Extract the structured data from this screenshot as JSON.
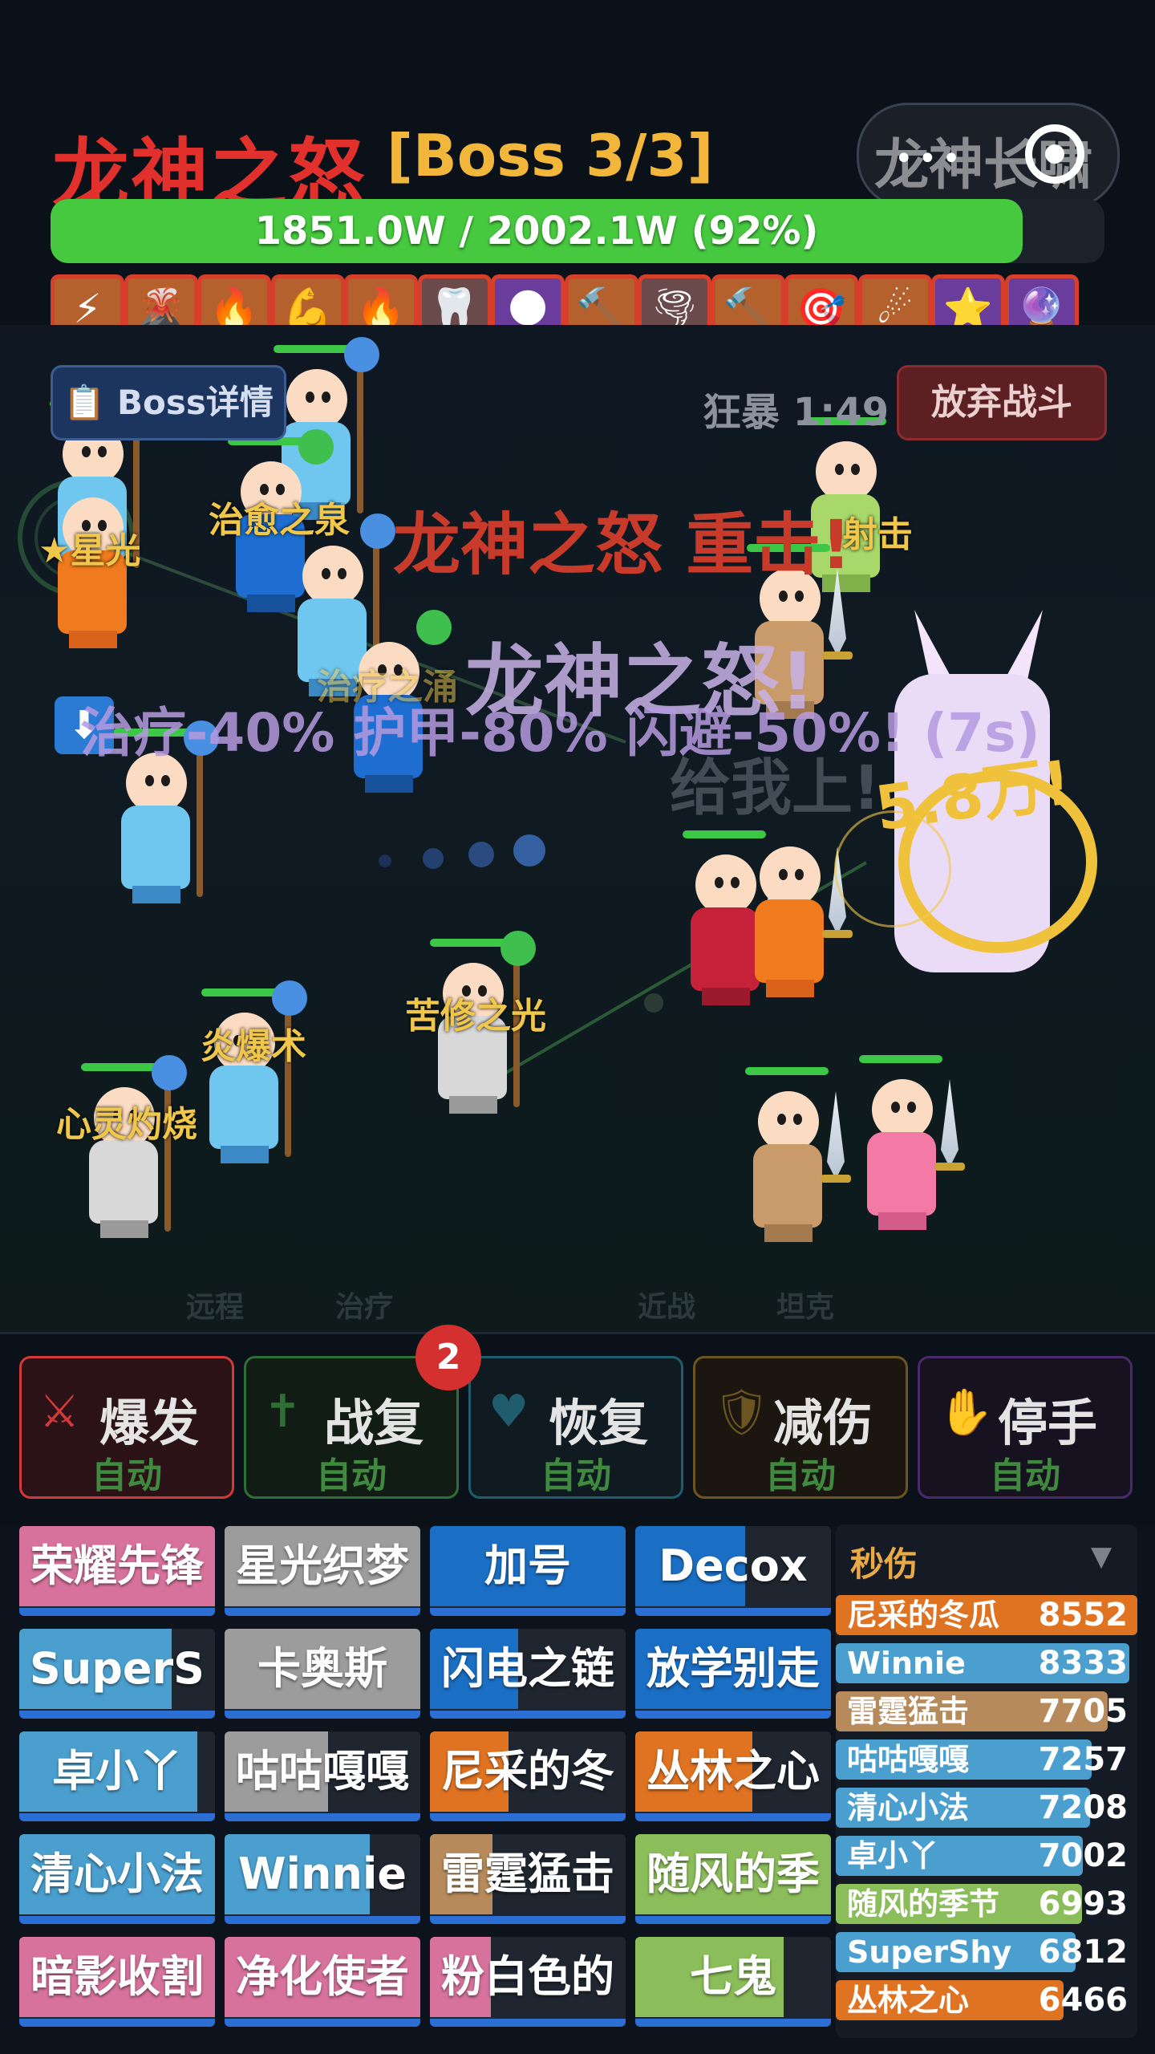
{
  "header": {
    "boss_name": "龙神之怒",
    "boss_count": "[Boss 3/3]",
    "capsule_title": "龙神长啸",
    "capsule_dots": "•••",
    "hp_text": "1851.0W / 2002.1W (92%)",
    "hp_ratio": 0.92,
    "buff_icons": [
      "⚡",
      "🌋",
      "🔥",
      "💪",
      "🔥",
      "🦷",
      "🌑",
      "🔨",
      "🌪",
      "🔨",
      "🎯",
      "☄",
      "⭐",
      "🔮"
    ]
  },
  "field": {
    "boss_detail_label": "📋 Boss详情",
    "frenzy_label": "狂暴 1:49",
    "abandon_label": "放弃战斗",
    "float_texts": {
      "crit": "龙神之怒 重击!",
      "wrath": "龙神之怒!",
      "debuff": "治疗-40% 护甲-80% 闪避-50%! (7s)",
      "debuff_icon": "⬇",
      "damage": "5.8万!",
      "taunt": "给我上!",
      "star": "★星光",
      "heal_flow": "治愈之泉",
      "heal_flow2": "治疗之涌",
      "shoot": "射击",
      "fire": "炎爆术",
      "ascetic": "苦修之光",
      "mind": "心灵灼烧"
    },
    "lane_labels": [
      "远程",
      "治疗",
      "近战",
      "坦克"
    ]
  },
  "stances": {
    "badge": "2",
    "items": [
      {
        "icon": "⚔",
        "name": "爆发",
        "auto": "自动",
        "color": "#d23a3a",
        "bg": "#2a1216",
        "auto_color": "#3f8a3f"
      },
      {
        "icon": "✝",
        "name": "战复",
        "auto": "自动",
        "color": "#2f6e37",
        "bg": "#101c14",
        "auto_color": "#3f8a3f"
      },
      {
        "icon": "♥",
        "name": "恢复",
        "auto": "自动",
        "color": "#1f5d6e",
        "bg": "#0f1b20",
        "auto_color": "#3f8a3f"
      },
      {
        "icon": "🛡",
        "name": "减伤",
        "auto": "自动",
        "color": "#6c5520",
        "bg": "#1b1710",
        "auto_color": "#3f8a3f"
      },
      {
        "icon": "✋",
        "name": "停手",
        "auto": "自动",
        "color": "#4a2a6a",
        "bg": "#16121f",
        "auto_color": "#3f8a3f"
      }
    ]
  },
  "raid": {
    "tiles": [
      {
        "name": "荣耀先锋",
        "color": "#d7729c",
        "hp": 1.0
      },
      {
        "name": "星光织梦",
        "color": "#9c9c9c",
        "hp": 1.0
      },
      {
        "name": "加号",
        "color": "#1a6ec4",
        "hp": 1.0
      },
      {
        "name": "Decox",
        "color": "#1a6ec4",
        "hp": 0.56
      },
      {
        "name": "SuperS",
        "color": "#4a9fcf",
        "hp": 0.78
      },
      {
        "name": "卡奥斯",
        "color": "#9c9c9c",
        "hp": 1.0
      },
      {
        "name": "闪电之链",
        "color": "#1a6ec4",
        "hp": 0.45
      },
      {
        "name": "放学别走",
        "color": "#1a6ec4",
        "hp": 1.0
      },
      {
        "name": "卓小丫",
        "color": "#4a9fcf",
        "hp": 0.91
      },
      {
        "name": "咕咕嘎嘎",
        "color": "#9c9c9c",
        "hp": 0.53
      },
      {
        "name": "尼采的冬",
        "color": "#e07321",
        "hp": 0.4
      },
      {
        "name": "丛林之心",
        "color": "#e07321",
        "hp": 0.6
      },
      {
        "name": "清心小法",
        "color": "#4a9fcf",
        "hp": 1.0
      },
      {
        "name": "Winnie",
        "color": "#4a9fcf",
        "hp": 0.74
      },
      {
        "name": "雷霆猛击",
        "color": "#b68a5a",
        "hp": 0.32
      },
      {
        "name": "随风的季",
        "color": "#8bbd5a",
        "hp": 1.0
      },
      {
        "name": "暗影收割",
        "color": "#d7729c",
        "hp": 1.0
      },
      {
        "name": "净化使者",
        "color": "#d7729c",
        "hp": 1.0
      },
      {
        "name": "粉白色的",
        "color": "#d7729c",
        "hp": 0.31
      },
      {
        "name": "七鬼",
        "color": "#8bbd5a",
        "hp": 0.76
      }
    ]
  },
  "meter": {
    "title": "秒伤",
    "arrow": "▼",
    "rows": [
      {
        "name": "尼采的冬瓜",
        "value": "8552",
        "color": "#e07321"
      },
      {
        "name": "Winnie",
        "value": "8333",
        "color": "#4a9fcf"
      },
      {
        "name": "雷霆猛击",
        "value": "7705",
        "color": "#b68a5a"
      },
      {
        "name": "咕咕嘎嘎",
        "value": "7257",
        "color": "#4a9fcf"
      },
      {
        "name": "清心小法",
        "value": "7208",
        "color": "#4a9fcf"
      },
      {
        "name": "卓小丫",
        "value": "7002",
        "color": "#4a9fcf"
      },
      {
        "name": "随风的季节",
        "value": "6993",
        "color": "#8bbd5a"
      },
      {
        "name": "SuperShy",
        "value": "6812",
        "color": "#4a9fcf"
      },
      {
        "name": "丛林之心",
        "value": "6466",
        "color": "#e07321"
      }
    ]
  }
}
